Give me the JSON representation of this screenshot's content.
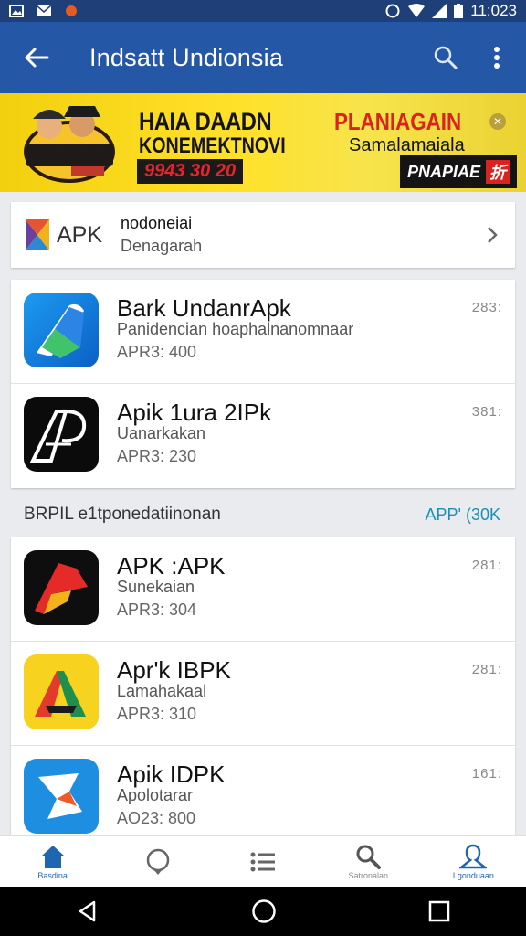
{
  "status_bar": {
    "time": "11:023"
  },
  "app_bar": {
    "title": "Indsatt Undionsia"
  },
  "banner": {
    "headline1": "HAIA DAADN",
    "headline2": "KONEMEKTNOVI",
    "price": "9943 30 20",
    "right_title": "PLANIAGAIN",
    "right_sub": "Samalamaiala",
    "cta": "PNAPIAE",
    "cta_badge": "折"
  },
  "apk_card": {
    "logo_text": "APK",
    "name": "nodoneiai",
    "subtitle": "Denagarah"
  },
  "featured_apps": [
    {
      "name": "Bark UndanrApk",
      "desc": "Panidencian hoaphalnanomnaar",
      "meta": "APR3: 400",
      "side": "283:"
    },
    {
      "name": "Apik 1ura 2IPk",
      "desc": "Uanarkakan",
      "meta": "APR3: 230",
      "side": "381:"
    }
  ],
  "section": {
    "title": "BRPIL e1tponedatiinonan",
    "link": "APP' (30K"
  },
  "more_apps": [
    {
      "name": "APK :APK",
      "desc": "Sunekaian",
      "meta": "APR3: 304",
      "side": "281:"
    },
    {
      "name": "Apr'k IBPK",
      "desc": "Lamahakaal",
      "meta": "APR3: 310",
      "side": "281:"
    },
    {
      "name": "Apik IDPK",
      "desc": "Apolotarar",
      "meta": "AO23: 800",
      "side": "161:"
    }
  ],
  "bottom_nav": [
    {
      "label": "Basdina",
      "icon": "home-icon"
    },
    {
      "label": "",
      "icon": "chat-icon"
    },
    {
      "label": "",
      "icon": "list-icon"
    },
    {
      "label": "Satronalan",
      "icon": "search-icon"
    },
    {
      "label": "Lgonduaan",
      "icon": "profile-icon"
    }
  ],
  "colors": {
    "app_bar": "#2557a7",
    "status_bar": "#1e3f78",
    "banner": "#f3d00e",
    "accent": "#1f66b0",
    "link": "#1a8fb8"
  }
}
